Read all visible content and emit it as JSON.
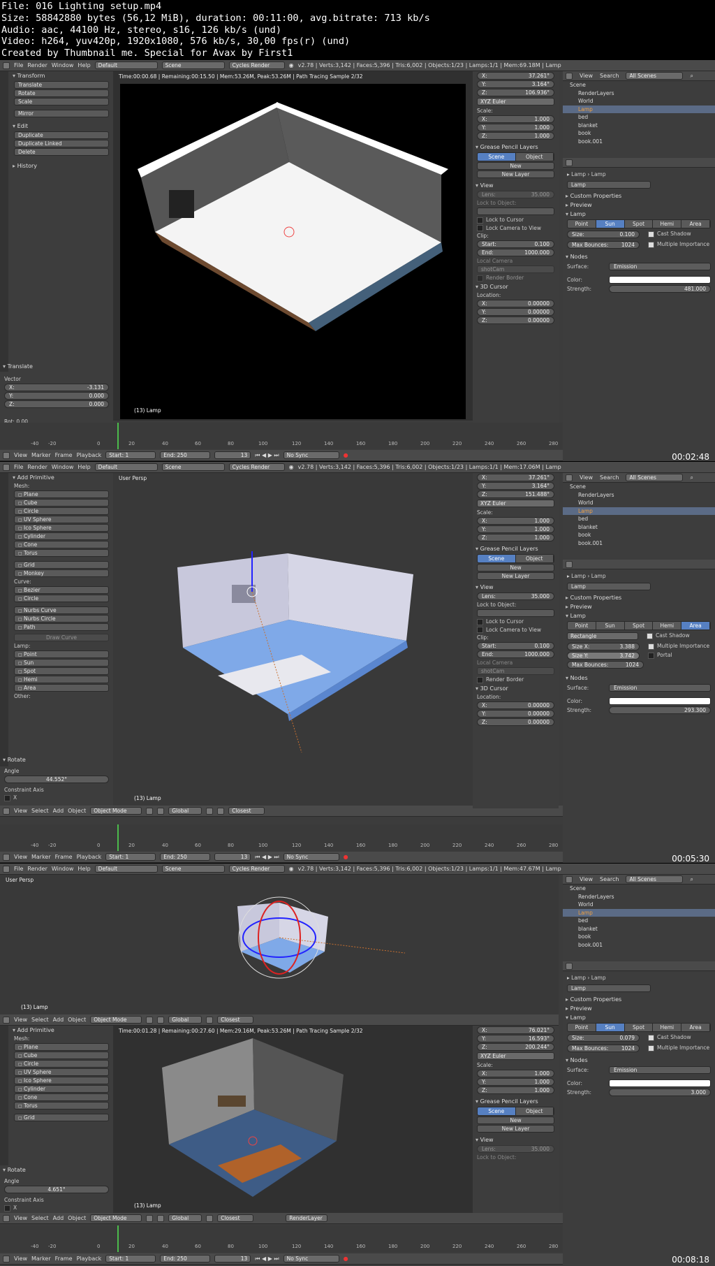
{
  "header": {
    "line1": "File: 016 Lighting setup.mp4",
    "line2": "Size: 58842880 bytes (56,12 MiB), duration: 00:11:00, avg.bitrate: 713 kb/s",
    "line3": "Audio: aac, 44100 Hz, stereo, s16, 126 kb/s (und)",
    "line4": "Video: h264, yuv420p, 1920x1080, 576 kb/s, 30,00 fps(r) (und)",
    "line5": "Created by Thumbnail me. Special for Avax by First1"
  },
  "colors": {
    "bg": "#3c3c3c",
    "panel": "#3d3d3d",
    "accent": "#5680c2",
    "frame_green": "#4cbb4c"
  },
  "menu": {
    "file": "File",
    "render": "Render",
    "window": "Window",
    "help": "Help",
    "layout": "Default",
    "scene": "Scene",
    "engine": "Cycles Render"
  },
  "frames": [
    {
      "timestamp": "00:02:48",
      "stats": "v2.78 | Verts:3,142 | Faces:5,396 | Tris:6,002 | Objects:1/23 | Lamps:1/1 | Mem:69.18M | Lamp",
      "viewport_title": "Time:00:00.68 | Remaining:00:15.50 | Mem:53.26M, Peak:53.26M | Path Tracing Sample 2/32",
      "viewport_label": "(13) Lamp",
      "tools": {
        "transform": "Transform",
        "translate": "Translate",
        "rotate": "Rotate",
        "scale": "Scale",
        "mirror": "Mirror",
        "edit": "Edit",
        "duplicate": "Duplicate",
        "duplicate_linked": "Duplicate Linked",
        "delete": "Delete",
        "history": "History"
      },
      "operator": {
        "title": "Translate",
        "vector": "Vector",
        "x": "-3.131",
        "y": "0.000",
        "z": "0.000",
        "rot": "Rot: 0.00"
      },
      "props": {
        "x": "37.261°",
        "y": "3.164°",
        "z": "106.936°",
        "euler": "XYZ Euler",
        "scale": "Scale:",
        "sx": "1.000",
        "sy": "1.000",
        "sz": "1.000",
        "grease": "Grease Pencil Layers",
        "scene": "Scene",
        "object": "Object",
        "new": "New",
        "new_layer": "New Layer",
        "view": "View",
        "lens": "Lens:",
        "lens_v": "35.000",
        "lock_obj": "Lock to Object:",
        "lock_cursor": "Lock to Cursor",
        "lock_cam": "Lock Camera to View",
        "clip": "Clip:",
        "start": "Start:",
        "start_v": "0.100",
        "end": "End:",
        "end_v": "1000.000",
        "local_cam": "Local Camera",
        "shotcam": "shotCam",
        "render_border": "Render Border",
        "cursor": "3D Cursor",
        "location": "Location:",
        "lx": "0.00000",
        "ly": "0.00000",
        "lz": "0.00000"
      },
      "outliner": {
        "view": "View",
        "search": "Search",
        "all_scenes": "All Scenes",
        "items": [
          "Scene",
          "RenderLayers",
          "World",
          "Lamp",
          "bed",
          "blanket",
          "book",
          "book.001"
        ]
      },
      "lamp": {
        "name": "Lamp",
        "crumb1": "Lamp",
        "crumb2": "Lamp",
        "custom": "Custom Properties",
        "preview": "Preview",
        "lamp": "Lamp",
        "types": [
          "Point",
          "Sun",
          "Spot",
          "Hemi",
          "Area"
        ],
        "active": 1,
        "size_label": "Size:",
        "size": "0.100",
        "cast_shadow": "Cast Shadow",
        "bounces_label": "Max Bounces:",
        "bounces": "1024",
        "mis": "Multiple Importance",
        "nodes": "Nodes",
        "surface": "Surface:",
        "emission": "Emission",
        "color": "Color:",
        "strength": "Strength:",
        "strength_v": "481.000"
      },
      "timeline": {
        "view": "View",
        "marker": "Marker",
        "frame": "Frame",
        "playback": "Playback",
        "start": "Start:",
        "start_v": "1",
        "end": "End:",
        "end_v": "250",
        "cur": "13",
        "sync": "No Sync"
      }
    },
    {
      "timestamp": "00:05:30",
      "stats": "v2.78 | Verts:3,142 | Faces:5,396 | Tris:6,002 | Objects:1/23 | Lamps:1/1 | Mem:17.06M | Lamp",
      "viewport_title": "User Persp",
      "viewport_label": "(13) Lamp",
      "tools": {
        "add": "Add Primitive",
        "mesh": "Mesh:",
        "items": [
          "Plane",
          "Cube",
          "Circle",
          "UV Sphere",
          "Ico Sphere",
          "Cylinder",
          "Cone",
          "Torus"
        ],
        "grid": "Grid",
        "monkey": "Monkey",
        "curve": "Curve:",
        "bezier": "Bezier",
        "circle2": "Circle",
        "nurbs_curve": "Nurbs Curve",
        "nurbs_circle": "Nurbs Circle",
        "path": "Path",
        "draw_curve": "Draw Curve",
        "lamp": "Lamp:",
        "lamps": [
          "Point",
          "Sun",
          "Spot",
          "Hemi",
          "Area"
        ],
        "other": "Other:"
      },
      "operator": {
        "title": "Rotate",
        "angle": "Angle",
        "angle_v": "44.552°",
        "constraint": "Constraint Axis",
        "cx": "X"
      },
      "props": {
        "x": "37.261°",
        "y": "3.164°",
        "z": "151.488°",
        "euler": "XYZ Euler",
        "scale": "Scale:",
        "sx": "1.000",
        "sy": "1.000",
        "sz": "1.000",
        "grease": "Grease Pencil Layers",
        "scene": "Scene",
        "object": "Object",
        "new": "New",
        "new_layer": "New Layer",
        "view": "View",
        "lens": "Lens:",
        "lens_v": "35.000",
        "lock_obj": "Lock to Object:",
        "lock_cursor": "Lock to Cursor",
        "lock_cam": "Lock Camera to View",
        "clip": "Clip:",
        "start": "Start:",
        "start_v": "0.100",
        "end": "End:",
        "end_v": "1000.000",
        "local_cam": "Local Camera",
        "shotcam": "shotCam",
        "render_border": "Render Border",
        "cursor": "3D Cursor",
        "location": "Location:",
        "lx": "0.00000",
        "ly": "0.00000",
        "lz": "0.00000"
      },
      "outliner": {
        "view": "View",
        "search": "Search",
        "all_scenes": "All Scenes",
        "items": [
          "Scene",
          "RenderLayers",
          "World",
          "Lamp",
          "bed",
          "blanket",
          "book",
          "book.001"
        ]
      },
      "lamp": {
        "name": "Lamp",
        "crumb1": "Lamp",
        "crumb2": "Lamp",
        "custom": "Custom Properties",
        "preview": "Preview",
        "lamp": "Lamp",
        "types": [
          "Point",
          "Sun",
          "Spot",
          "Hemi",
          "Area"
        ],
        "active": 4,
        "shape": "Rectangle",
        "size_x_label": "Size X:",
        "size_x": "3.388",
        "size_y_label": "Size Y:",
        "size_y": "3.742",
        "bounces_label": "Max Bounces:",
        "bounces": "1024",
        "cast_shadow": "Cast Shadow",
        "mis": "Multiple Importance",
        "portal": "Portal",
        "nodes": "Nodes",
        "surface": "Surface:",
        "emission": "Emission",
        "color": "Color:",
        "strength": "Strength:",
        "strength_v": "293.300"
      },
      "viewbar": {
        "view": "View",
        "select": "Select",
        "add": "Add",
        "object": "Object",
        "mode": "Object Mode",
        "global": "Global",
        "closest": "Closest"
      },
      "timeline": {
        "view": "View",
        "marker": "Marker",
        "frame": "Frame",
        "playback": "Playback",
        "start": "Start:",
        "start_v": "1",
        "end": "End:",
        "end_v": "250",
        "cur": "13",
        "sync": "No Sync"
      }
    },
    {
      "timestamp": "00:08:18",
      "stats": "v2.78 | Verts:3,142 | Faces:5,396 | Tris:6,002 | Objects:1/23 | Lamps:1/1 | Mem:47.67M | Lamp",
      "top_title": "User Persp",
      "top_label": "(13) Lamp",
      "viewport_title": "Time:00:01.28 | Remaining:00:27.60 | Mem:29.16M, Peak:53.26M | Path Tracing Sample 2/32",
      "viewport_label": "(13) Lamp",
      "tools": {
        "add": "Add Primitive",
        "mesh": "Mesh:",
        "items": [
          "Plane",
          "Cube",
          "Circle",
          "UV Sphere",
          "Ico Sphere",
          "Cylinder",
          "Cone",
          "Torus"
        ],
        "grid": "Grid"
      },
      "operator": {
        "title": "Rotate",
        "angle": "Angle",
        "angle_v": "4.651°",
        "constraint": "Constraint Axis",
        "cx": "X"
      },
      "props": {
        "x": "76.021°",
        "y": "16.593°",
        "z": "200.244°",
        "euler": "XYZ Euler",
        "scale": "Scale:",
        "sx": "1.000",
        "sy": "1.000",
        "sz": "1.000",
        "grease": "Grease Pencil Layers",
        "scene": "Scene",
        "object": "Object",
        "new": "New",
        "new_layer": "New Layer",
        "view": "View",
        "lens": "Lens:",
        "lens_v": "35.000",
        "lock_obj": "Lock to Object:"
      },
      "outliner": {
        "view": "View",
        "search": "Search",
        "all_scenes": "All Scenes",
        "items": [
          "Scene",
          "RenderLayers",
          "World",
          "Lamp",
          "bed",
          "blanket",
          "book",
          "book.001"
        ]
      },
      "lamp": {
        "name": "Lamp",
        "crumb1": "Lamp",
        "crumb2": "Lamp",
        "custom": "Custom Properties",
        "preview": "Preview",
        "lamp": "Lamp",
        "types": [
          "Point",
          "Sun",
          "Spot",
          "Hemi",
          "Area"
        ],
        "active": 1,
        "size_label": "Size:",
        "size": "0.079",
        "cast_shadow": "Cast Shadow",
        "bounces_label": "Max Bounces:",
        "bounces": "1024",
        "mis": "Multiple Importance",
        "nodes": "Nodes",
        "surface": "Surface:",
        "emission": "Emission",
        "color": "Color:",
        "strength": "Strength:",
        "strength_v": "3.000"
      },
      "viewbar": {
        "view": "View",
        "select": "Select",
        "add": "Add",
        "object": "Object",
        "mode": "Object Mode",
        "global": "Global",
        "closest": "Closest",
        "render_layer": "RenderLayer"
      },
      "timeline": {
        "view": "View",
        "marker": "Marker",
        "frame": "Frame",
        "playback": "Playback",
        "start": "Start:",
        "start_v": "1",
        "end": "End:",
        "end_v": "250",
        "cur": "13",
        "sync": "No Sync"
      }
    }
  ],
  "ruler": [
    "-40",
    "-20",
    "0",
    "20",
    "40",
    "60",
    "80",
    "100",
    "120",
    "140",
    "160",
    "180",
    "200",
    "220",
    "240",
    "260",
    "280"
  ]
}
